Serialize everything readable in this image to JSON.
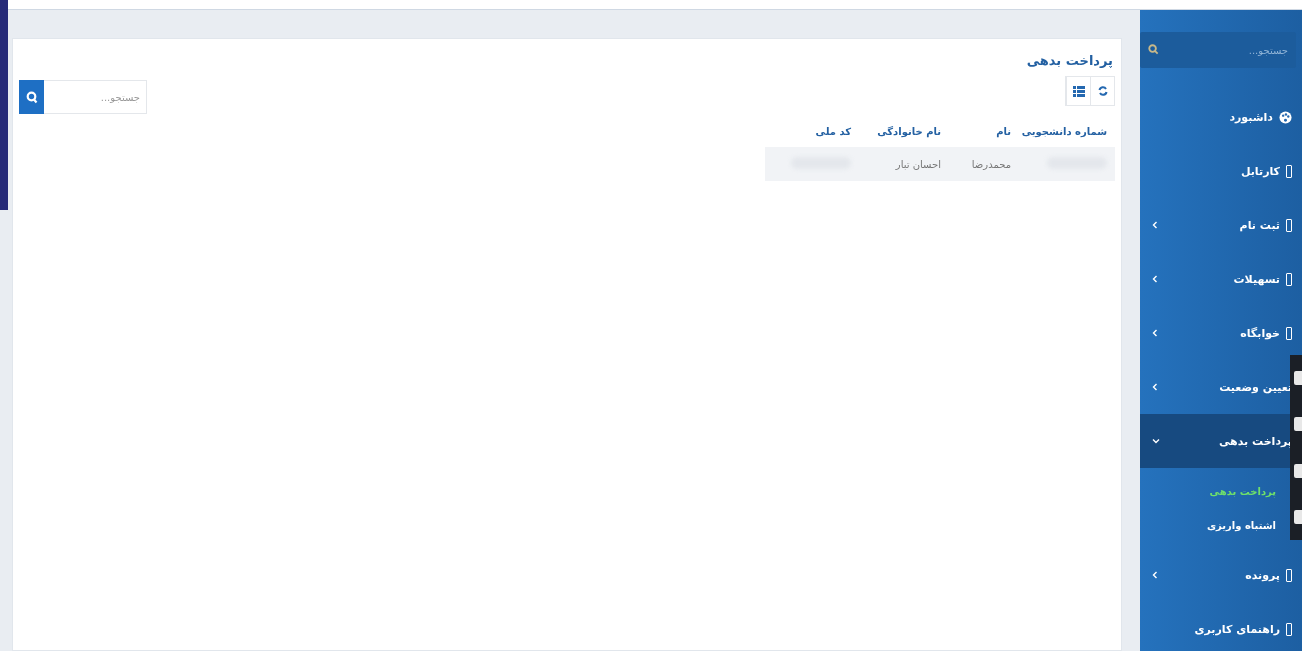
{
  "sidebar": {
    "search": {
      "placeholder": "جستجو..."
    },
    "items": [
      {
        "label": "داشبورد",
        "kind": "dashboard"
      },
      {
        "label": "کارتابل",
        "kind": "page"
      },
      {
        "label": "ثبت نام",
        "kind": "page",
        "expanded": false
      },
      {
        "label": "تسهیلات",
        "kind": "page",
        "expanded": false
      },
      {
        "label": "خوابگاه",
        "kind": "page",
        "expanded": false
      },
      {
        "label": "تعیین وضعیت",
        "kind": "plain",
        "expanded": false
      },
      {
        "label": "پرداخت بدهی",
        "kind": "plain",
        "expanded": true,
        "children": [
          {
            "label": "پرداخت بدهی",
            "selected": true
          },
          {
            "label": "اشتباه واریزی",
            "selected": false
          }
        ]
      },
      {
        "label": "پرونده",
        "kind": "page",
        "expanded": false
      },
      {
        "label": "راهنمای کاربری",
        "kind": "page"
      }
    ]
  },
  "page": {
    "title": "پرداخت بدهی",
    "search": {
      "placeholder": "جستجو..."
    },
    "table": {
      "columns": [
        "شماره دانشجویی",
        "نام",
        "نام خانوادگی",
        "کد ملی"
      ],
      "rows": [
        [
          {
            "kind": "redacted"
          },
          {
            "kind": "text",
            "text": "محمدرضا"
          },
          {
            "kind": "text",
            "text": "احسان تبار"
          },
          {
            "kind": "redacted"
          }
        ]
      ]
    }
  }
}
